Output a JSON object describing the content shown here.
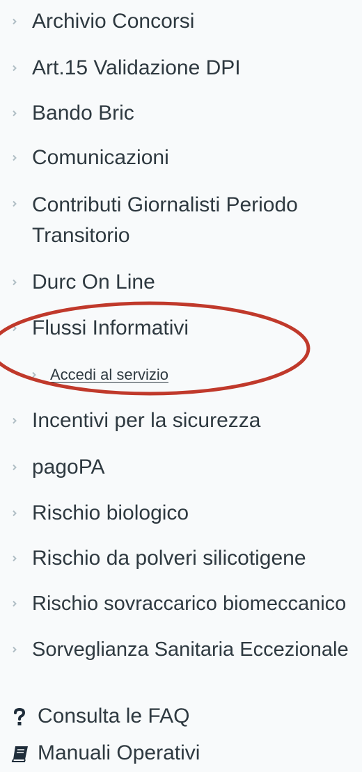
{
  "menu": {
    "items": [
      {
        "label": "Archivio Concorsi"
      },
      {
        "label": "Art.15 Validazione DPI"
      },
      {
        "label": "Bando Bric"
      },
      {
        "label": "Comunicazioni"
      },
      {
        "label": "Contributi Giornalisti Periodo Transitorio"
      },
      {
        "label": "Durc On Line"
      },
      {
        "label": "Flussi Informativi"
      },
      {
        "label": "Incentivi per la sicurezza"
      },
      {
        "label": "pagoPA"
      },
      {
        "label": "Rischio biologico"
      },
      {
        "label": "Rischio da polveri silicotigene"
      },
      {
        "label": "Rischio sovraccarico biomeccanico"
      },
      {
        "label": "Sorveglianza Sanitaria Eccezionale"
      }
    ],
    "subitem": {
      "label": "Accedi al servizio"
    }
  },
  "tools": {
    "faq": {
      "label": "Consulta le FAQ",
      "icon": "question-icon"
    },
    "manuals": {
      "label": "Manuali Operativi",
      "icon": "book-icon"
    }
  },
  "colors": {
    "text": "#2e3940",
    "chevron": "#b0bec5",
    "highlight": "#c0392b",
    "icon": "#1f2d3a"
  }
}
